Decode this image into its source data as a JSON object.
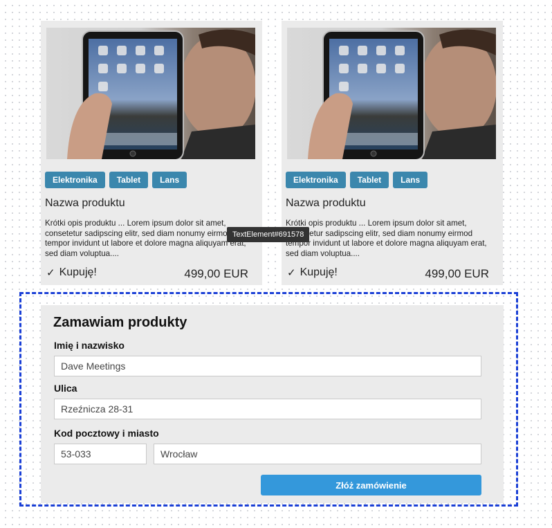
{
  "products": [
    {
      "tags": [
        "Elektronika",
        "Tablet",
        "Lans"
      ],
      "name": "Nazwa produktu",
      "description": "Krótki opis produktu ... Lorem ipsum dolor sit amet, consetetur sadipscing elitr, sed diam nonumy eirmod tempor invidunt ut labore et dolore magna aliquyam erat, sed diam voluptua....",
      "buy_label": "Kupuję!",
      "price": "499,00 EUR"
    },
    {
      "tags": [
        "Elektronika",
        "Tablet",
        "Lans"
      ],
      "name": "Nazwa produktu",
      "description": "Krótki opis produktu ... Lorem ipsum dolor sit amet, consetetur sadipscing elitr, sed diam nonumy eirmod tempor invidunt ut labore et dolore magna aliquyam erat, sed diam voluptua....",
      "buy_label": "Kupuję!",
      "price": "499,00 EUR"
    }
  ],
  "tooltip": "TextElement#691578",
  "order_form": {
    "title": "Zamawiam produkty",
    "name_label": "Imię i nazwisko",
    "name_value": "Dave Meetings",
    "street_label": "Ulica",
    "street_value": "Rzeźnicza 28-31",
    "postal_city_label": "Kod pocztowy i miasto",
    "postal_value": "53-033",
    "city_value": "Wrocław",
    "submit_label": "Złóż zamówienie"
  },
  "colors": {
    "tag_bg": "#3b87ad",
    "submit_bg": "#3498db",
    "selection_border": "#1a3fd6",
    "card_bg": "#ebebeb"
  }
}
